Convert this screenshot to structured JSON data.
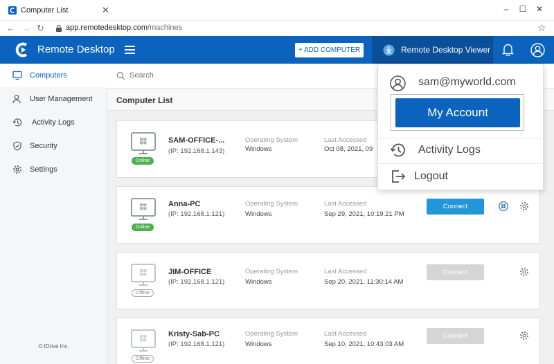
{
  "browser": {
    "tab_title": "Computer List",
    "url_host": "app.remotedesktop.com",
    "url_path": "/machines",
    "close_glyph": "✕",
    "minimize_glyph": "–",
    "maximize_glyph": "☐",
    "window_close_glyph": "✕",
    "back_glyph": "←",
    "forward_glyph": "→",
    "reload_glyph": "↻",
    "star_glyph": "☆"
  },
  "header": {
    "brand": "Remote Desktop",
    "add_computer": "+ ADD COMPUTER",
    "viewer_label": "Remote Desktop Viewer",
    "brand_color": "#0b63bd"
  },
  "sidebar": {
    "items": [
      {
        "label": "Computers",
        "icon": "monitor-icon",
        "active": true
      },
      {
        "label": "User Management",
        "icon": "user-icon",
        "active": false
      },
      {
        "label": "Activity Logs",
        "icon": "history-icon",
        "active": false
      },
      {
        "label": "Security",
        "icon": "shield-icon",
        "active": false
      },
      {
        "label": "Settings",
        "icon": "gear-icon",
        "active": false
      }
    ],
    "copyright": "© IDrive Inc."
  },
  "main": {
    "search_placeholder": "Search",
    "list_title": "Computer List",
    "os_label": "Operating System",
    "last_label": "Last Accessed",
    "connect_label": "Connect",
    "computers": [
      {
        "name": "SAM-OFFICE-...",
        "ip": "(IP: 192.168.1.143)",
        "os": "Windows",
        "last": "Oct 08, 2021, 09",
        "status": "Online"
      },
      {
        "name": "Anna-PC",
        "ip": "(IP: 192.168.1.121)",
        "os": "Windows",
        "last": "Sep 29, 2021, 10:19:21 PM",
        "status": "Online"
      },
      {
        "name": "JIM-OFFICE",
        "ip": "(IP: 192.168.1.121)",
        "os": "Windows",
        "last": "Sep 20, 2021, 11:30:14 AM",
        "status": "Offline"
      },
      {
        "name": "Kristy-Sab-PC",
        "ip": "(IP: 192.168.1.121)",
        "os": "Windows",
        "last": "Sep 10, 2021, 10:43:03 AM",
        "status": "Offline"
      }
    ]
  },
  "dropdown": {
    "email": "sam@myworld.com",
    "my_account": "My Account",
    "activity_logs": "Activity Logs",
    "logout": "Logout"
  }
}
